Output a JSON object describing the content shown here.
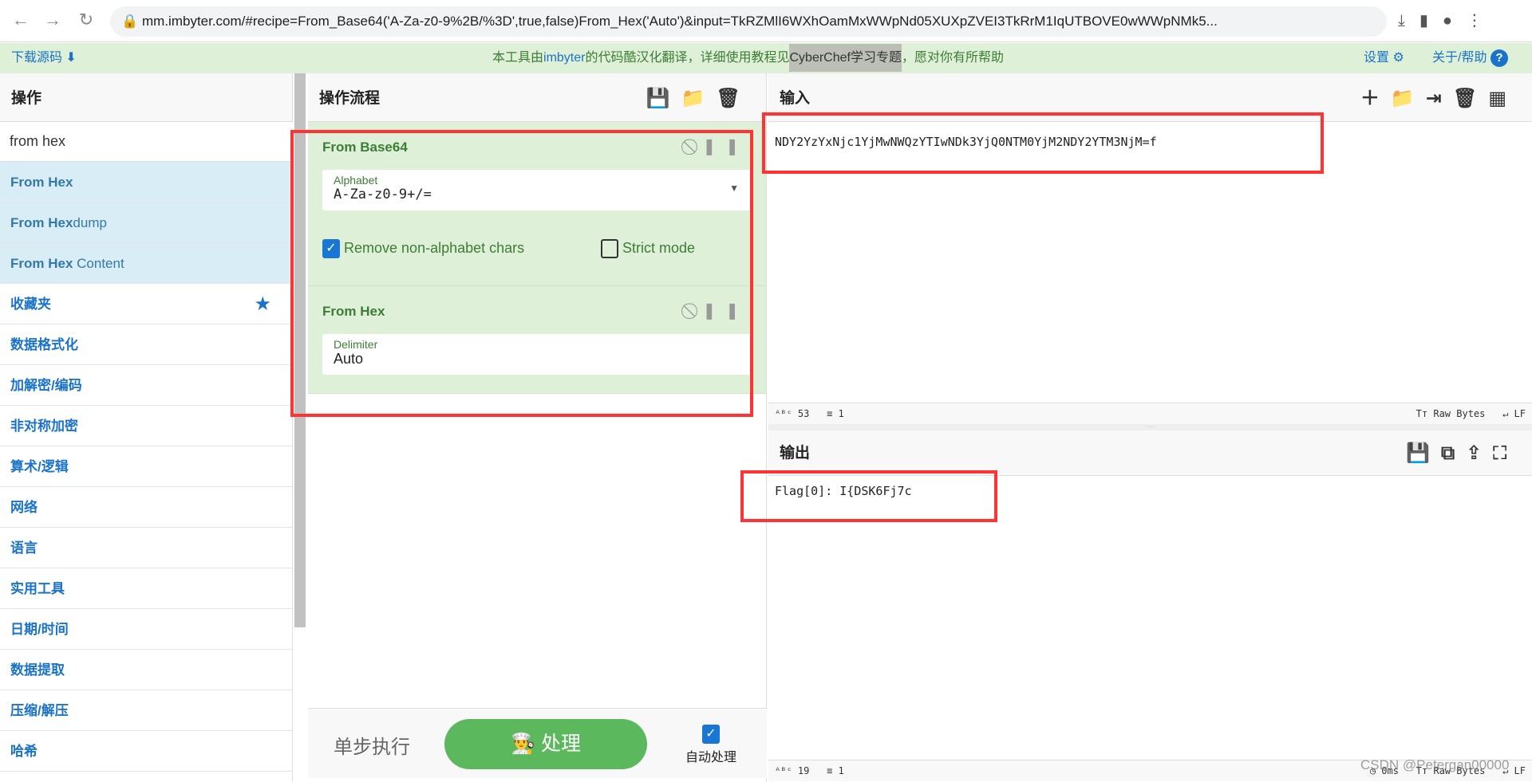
{
  "browser": {
    "url": "mm.imbyter.com/#recipe=From_Base64('A-Za-z0-9%2B/%3D',true,false)From_Hex('Auto')&input=TkRZMlI6WXhOamMxWWpNd05XUXpZVEI3TkRrM1IqUTBOVE0wWWpNMk5..."
  },
  "banner": {
    "download": "下载源码",
    "notice_a": "本工具由",
    "imbyter": "imbyter",
    "notice_b": "的代码酷汉化翻译，详细使用教程见",
    "cyberchef": "CyberChef学习专题",
    "notice_c": "，愿对你有所帮助",
    "settings": "设置",
    "about": "关于/帮助"
  },
  "operations": {
    "title": "操作",
    "search_value": "from hex",
    "results": [
      {
        "bold": "From Hex",
        "rest": ""
      },
      {
        "bold": "From Hex",
        "rest": "dump"
      },
      {
        "bold": "From Hex",
        "rest": " Content"
      }
    ],
    "categories": [
      "收藏夹",
      "数据格式化",
      "加解密/编码",
      "非对称加密",
      "算术/逻辑",
      "网络",
      "语言",
      "实用工具",
      "日期/时间",
      "数据提取",
      "压缩/解压",
      "哈希"
    ]
  },
  "recipe": {
    "title": "操作流程",
    "ops": [
      {
        "name": "From Base64",
        "field_label": "Alphabet",
        "field_value": "A-Za-z0-9+/=",
        "check1": "Remove non-alphabet chars",
        "check1_on": true,
        "check2": "Strict mode",
        "check2_on": false
      },
      {
        "name": "From Hex",
        "field_label": "Delimiter",
        "field_value": "Auto"
      }
    ],
    "step": "单步执行",
    "bake": "处理",
    "autobake": "自动处理",
    "autobake_on": true
  },
  "input": {
    "title": "输入",
    "value": "NDY2YzYxNjc1YjMwNWQzYTIwNDk3YjQ0NTM0YjM2NDY2YTM3NjM=f",
    "chars": "53",
    "lines": "1",
    "encoding": "Raw Bytes",
    "eol": "LF"
  },
  "output": {
    "title": "输出",
    "value": "Flag[0]: I{DSK6Fj7c",
    "chars": "19",
    "lines": "1",
    "time": "0ms",
    "encoding": "Raw Bytes",
    "eol": "LF"
  },
  "watermark": "CSDN @Petergan00000",
  "colors": {
    "accent": "#1976d2",
    "op_bg": "#dff0d8",
    "bake": "#5cb85c",
    "highlight": "#ff3333"
  }
}
